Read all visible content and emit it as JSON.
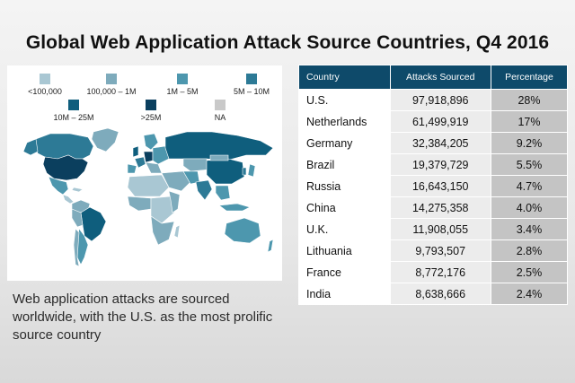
{
  "title": "Global Web Application Attack Source Countries, Q4 2016",
  "description": "Web application attacks are sourced worldwide, with the U.S. as the most prolific source country",
  "colors": {
    "lt100k": "#a9c7d3",
    "100k_1m": "#7eabbc",
    "1m_5m": "#4d97ae",
    "5m_10m": "#2d7a96",
    "10m_25m": "#0f5e7d",
    "gt25m": "#0b3f5e",
    "na": "#c9c9c9",
    "header": "#0e4a6a"
  },
  "legend": [
    {
      "label": "<100,000",
      "color": "#a9c7d3"
    },
    {
      "label": "100,000 – 1M",
      "color": "#7eabbc"
    },
    {
      "label": "1M – 5M",
      "color": "#4d97ae"
    },
    {
      "label": "5M – 10M",
      "color": "#2d7a96"
    },
    {
      "label": "10M – 25M",
      "color": "#0f5e7d"
    },
    {
      "label": ">25M",
      "color": "#0b3f5e"
    },
    {
      "label": "NA",
      "color": "#c9c9c9"
    }
  ],
  "chart_data": {
    "type": "table",
    "columns": [
      "Country",
      "Attacks Sourced",
      "Percentage"
    ],
    "rows": [
      {
        "country": "U.S.",
        "attacks": "97,918,896",
        "percentage": "28%"
      },
      {
        "country": "Netherlands",
        "attacks": "61,499,919",
        "percentage": "17%"
      },
      {
        "country": "Germany",
        "attacks": "32,384,205",
        "percentage": "9.2%"
      },
      {
        "country": "Brazil",
        "attacks": "19,379,729",
        "percentage": "5.5%"
      },
      {
        "country": "Russia",
        "attacks": "16,643,150",
        "percentage": "4.7%"
      },
      {
        "country": "China",
        "attacks": "14,275,358",
        "percentage": "4.0%"
      },
      {
        "country": "U.K.",
        "attacks": "11,908,055",
        "percentage": "3.4%"
      },
      {
        "country": "Lithuania",
        "attacks": "9,793,507",
        "percentage": "2.8%"
      },
      {
        "country": "France",
        "attacks": "8,772,176",
        "percentage": "2.5%"
      },
      {
        "country": "India",
        "attacks": "8,638,666",
        "percentage": "2.4%"
      }
    ]
  }
}
